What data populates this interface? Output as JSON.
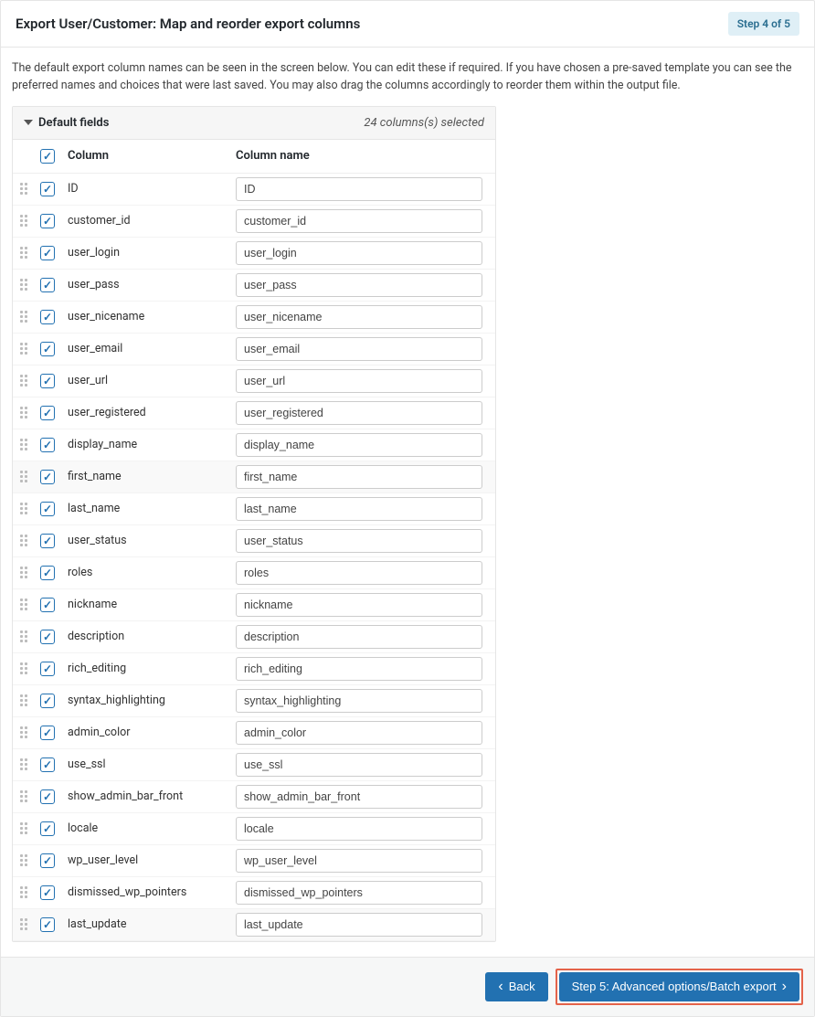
{
  "header": {
    "title": "Export User/Customer: Map and reorder export columns",
    "step_label": "Step 4 of 5"
  },
  "intro": "The default export column names can be seen in the screen below. You can edit these if required. If you have chosen a pre-saved template you can see the preferred names and choices that were last saved. You may also drag the columns accordingly to reorder them within the output file.",
  "fields_section": {
    "title": "Default fields",
    "count_label": "24 columns(s) selected",
    "col_header_column": "Column",
    "col_header_name": "Column name"
  },
  "rows": [
    {
      "label": "ID",
      "value": "ID"
    },
    {
      "label": "customer_id",
      "value": "customer_id"
    },
    {
      "label": "user_login",
      "value": "user_login"
    },
    {
      "label": "user_pass",
      "value": "user_pass"
    },
    {
      "label": "user_nicename",
      "value": "user_nicename"
    },
    {
      "label": "user_email",
      "value": "user_email"
    },
    {
      "label": "user_url",
      "value": "user_url"
    },
    {
      "label": "user_registered",
      "value": "user_registered"
    },
    {
      "label": "display_name",
      "value": "display_name"
    },
    {
      "label": "first_name",
      "value": "first_name",
      "highlight": true
    },
    {
      "label": "last_name",
      "value": "last_name"
    },
    {
      "label": "user_status",
      "value": "user_status"
    },
    {
      "label": "roles",
      "value": "roles"
    },
    {
      "label": "nickname",
      "value": "nickname"
    },
    {
      "label": "description",
      "value": "description"
    },
    {
      "label": "rich_editing",
      "value": "rich_editing"
    },
    {
      "label": "syntax_highlighting",
      "value": "syntax_highlighting"
    },
    {
      "label": "admin_color",
      "value": "admin_color"
    },
    {
      "label": "use_ssl",
      "value": "use_ssl"
    },
    {
      "label": "show_admin_bar_front",
      "value": "show_admin_bar_front"
    },
    {
      "label": "locale",
      "value": "locale"
    },
    {
      "label": "wp_user_level",
      "value": "wp_user_level"
    },
    {
      "label": "dismissed_wp_pointers",
      "value": "dismissed_wp_pointers"
    },
    {
      "label": "last_update",
      "value": "last_update",
      "highlight": true
    }
  ],
  "footer": {
    "back_label": "Back",
    "next_label": "Step 5: Advanced options/Batch export"
  }
}
